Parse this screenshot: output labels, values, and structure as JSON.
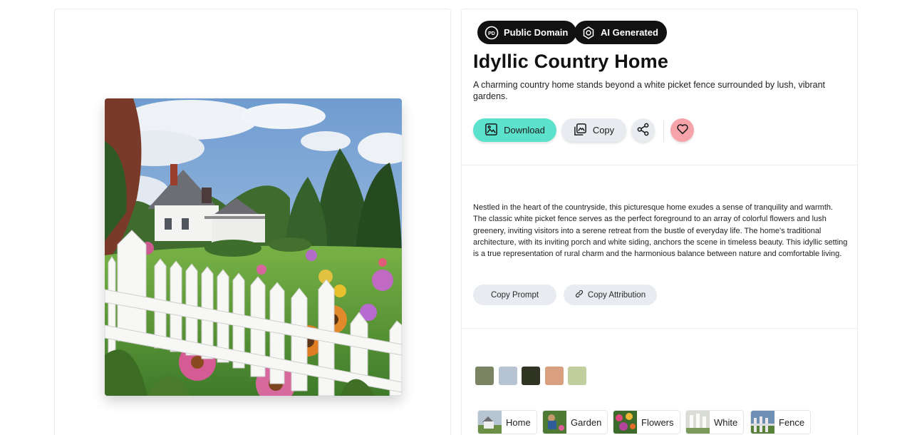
{
  "image": {
    "alt": "Idyllic Country Home"
  },
  "badges": {
    "public_domain": "Public Domain",
    "public_domain_icon_text": "PD",
    "ai_generated": "AI Generated"
  },
  "header": {
    "title": "Idyllic Country Home",
    "subtitle": "A charming country home stands beyond a white picket fence surrounded by lush, vibrant gardens."
  },
  "actions": {
    "download_label": "Download",
    "copy_label": "Copy",
    "share_icon": "share-icon",
    "like_icon": "heart-icon"
  },
  "description": "Nestled in the heart of the countryside, this picturesque home exudes a sense of tranquility and warmth. The classic white picket fence serves as the perfect foreground to an array of colorful flowers and lush greenery, inviting visitors into a serene retreat from the bustle of everyday life. The home's traditional architecture, with its inviting porch and white siding, anchors the scene in timeless beauty. This idyllic setting is a true representation of rural charm and the harmonious balance between nature and comfortable living.",
  "prompt_actions": {
    "copy_prompt": "Copy Prompt",
    "copy_attribution": "Copy Attribution"
  },
  "palette": [
    "#7a8462",
    "#b5c3d3",
    "#2f3522",
    "#d9a07f",
    "#c1cf9f"
  ],
  "colors": {
    "download_accent": "#5ce1cc",
    "like_accent": "#f7a3aa",
    "badge_bg": "#111111",
    "pill_bg": "#e8ebf0"
  },
  "tags": [
    {
      "label": "Home"
    },
    {
      "label": "Garden"
    },
    {
      "label": "Flowers"
    },
    {
      "label": "White"
    },
    {
      "label": "Fence"
    }
  ]
}
